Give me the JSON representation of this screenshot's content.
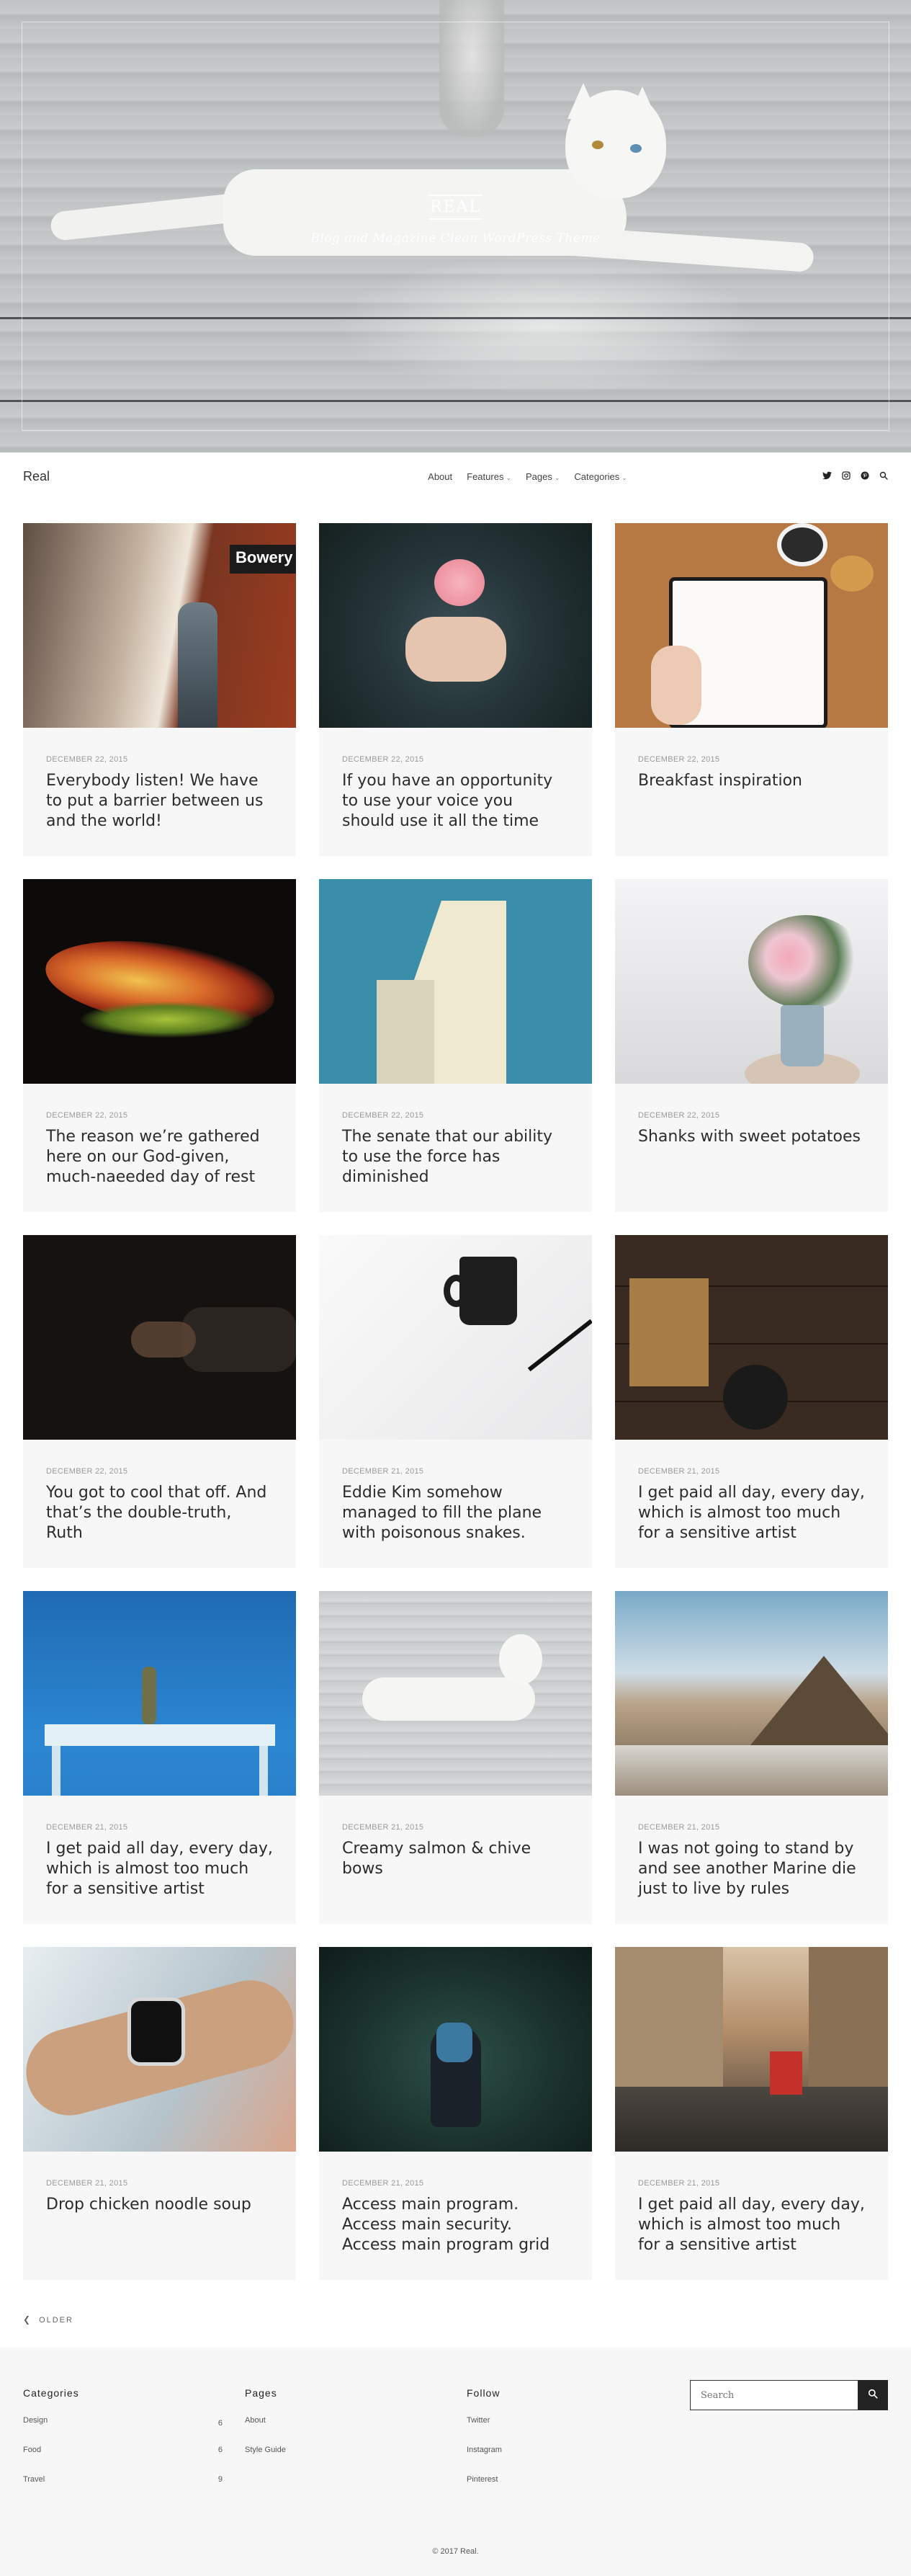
{
  "hero": {
    "site_title": "REAL",
    "tagline": "Blog and Magazine Clean WordPress Theme"
  },
  "nav": {
    "site_name": "Real",
    "menu": [
      {
        "label": "About",
        "dropdown": false
      },
      {
        "label": "Features",
        "dropdown": true
      },
      {
        "label": "Pages",
        "dropdown": true
      },
      {
        "label": "Categories",
        "dropdown": true
      }
    ],
    "icons": [
      "twitter-icon",
      "instagram-icon",
      "pinterest-icon",
      "search-icon"
    ]
  },
  "posts": [
    {
      "date": "December 22, 2015",
      "title": "Everybody listen! We have to put a barrier between us and the world!",
      "image": "subway-platform"
    },
    {
      "date": "December 22, 2015",
      "title": "If you have an opportunity to use your voice you should use it all the time",
      "image": "hands-holding-rose"
    },
    {
      "date": "December 22, 2015",
      "title": "Breakfast inspiration",
      "image": "journal-coffee-croissant"
    },
    {
      "date": "December 22, 2015",
      "title": "The reason we’re gathered here on our God-given, much-naeeded day of rest",
      "image": "abstract-colorful-texture"
    },
    {
      "date": "December 22, 2015",
      "title": "The senate that our ability to use the force has diminished",
      "image": "white-building-blue-sky"
    },
    {
      "date": "December 22, 2015",
      "title": "Shanks with sweet potatoes",
      "image": "flowers-in-vase"
    },
    {
      "date": "December 22, 2015",
      "title": "You got to cool that off. And that’s the double-truth, Ruth",
      "image": "hand-with-phone-dark"
    },
    {
      "date": "December 21, 2015",
      "title": "Eddie Kim somehow managed to fill the plane with poisonous snakes.",
      "image": "mug-and-pen"
    },
    {
      "date": "December 21, 2015",
      "title": "I get paid all day, every day, which is almost too much for a sensitive artist",
      "image": "kitchen-table-flatlay"
    },
    {
      "date": "December 21, 2015",
      "title": "I get paid all day, every day, which is almost too much for a sensitive artist",
      "image": "desk-blue-wall"
    },
    {
      "date": "December 21, 2015",
      "title": "Creamy salmon & chive bows",
      "image": "white-cat-wood"
    },
    {
      "date": "December 21, 2015",
      "title": "I was not going to stand by and see another Marine die just to live by rules",
      "image": "mountains"
    },
    {
      "date": "December 21, 2015",
      "title": "Drop chicken noodle soup",
      "image": "smartwatch-wrist"
    },
    {
      "date": "December 21, 2015",
      "title": "Access main program. Access main security. Access main program grid",
      "image": "hiker-forest"
    },
    {
      "date": "December 21, 2015",
      "title": "I get paid all day, every day, which is almost too much for a sensitive artist",
      "image": "city-street-bus"
    }
  ],
  "pagination": {
    "older_label": "OLDER"
  },
  "footer": {
    "categories": {
      "heading": "Categories",
      "items": [
        {
          "label": "Design",
          "count": "6"
        },
        {
          "label": "Food",
          "count": "6"
        },
        {
          "label": "Travel",
          "count": "9"
        }
      ]
    },
    "pages": {
      "heading": "Pages",
      "items": [
        {
          "label": "About"
        },
        {
          "label": "Style Guide"
        }
      ]
    },
    "follow": {
      "heading": "Follow",
      "items": [
        {
          "label": "Twitter"
        },
        {
          "label": "Instagram"
        },
        {
          "label": "Pinterest"
        }
      ]
    },
    "search": {
      "placeholder": "Search"
    },
    "copyright": "© 2017 Real."
  }
}
